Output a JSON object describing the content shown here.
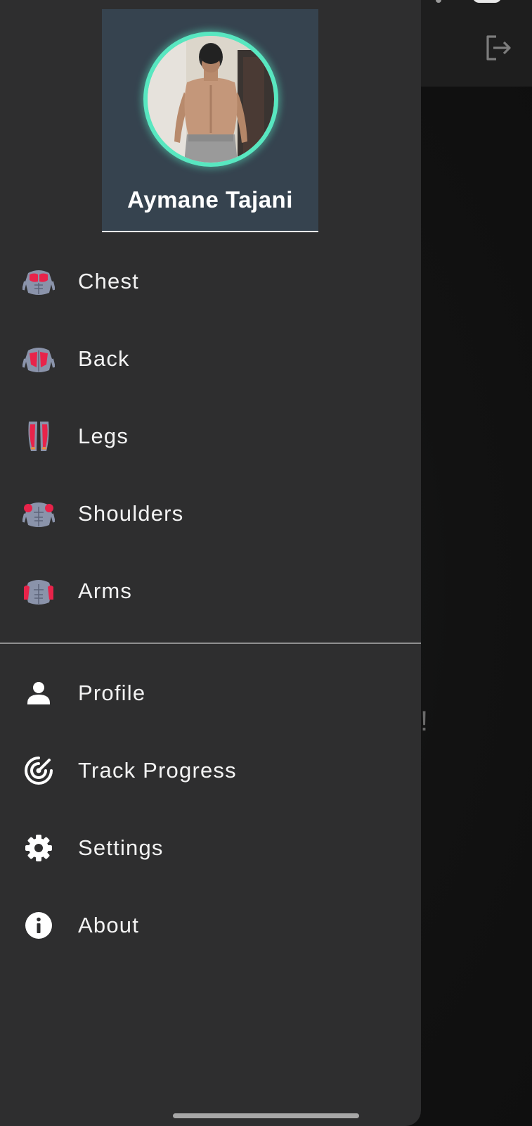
{
  "drawer": {
    "user_name": "Aymane Tajani",
    "workout_items": [
      {
        "label": "Chest",
        "icon": "chest-muscle-icon"
      },
      {
        "label": "Back",
        "icon": "back-muscle-icon"
      },
      {
        "label": "Legs",
        "icon": "legs-muscle-icon"
      },
      {
        "label": "Shoulders",
        "icon": "shoulders-muscle-icon"
      },
      {
        "label": "Arms",
        "icon": "arms-muscle-icon"
      }
    ],
    "app_items": [
      {
        "label": "Profile",
        "icon": "person-icon"
      },
      {
        "label": "Track Progress",
        "icon": "radar-icon"
      },
      {
        "label": "Settings",
        "icon": "gear-icon"
      },
      {
        "label": "About",
        "icon": "info-icon"
      }
    ]
  },
  "background": {
    "logout_icon": "logout-icon",
    "partial_text": "!"
  },
  "colors": {
    "drawer_bg": "#2e2e2f",
    "header_bg": "#36434f",
    "avatar_ring": "#58e7c0",
    "muscle_highlight": "#e8234a",
    "text": "#f3f3f3"
  }
}
